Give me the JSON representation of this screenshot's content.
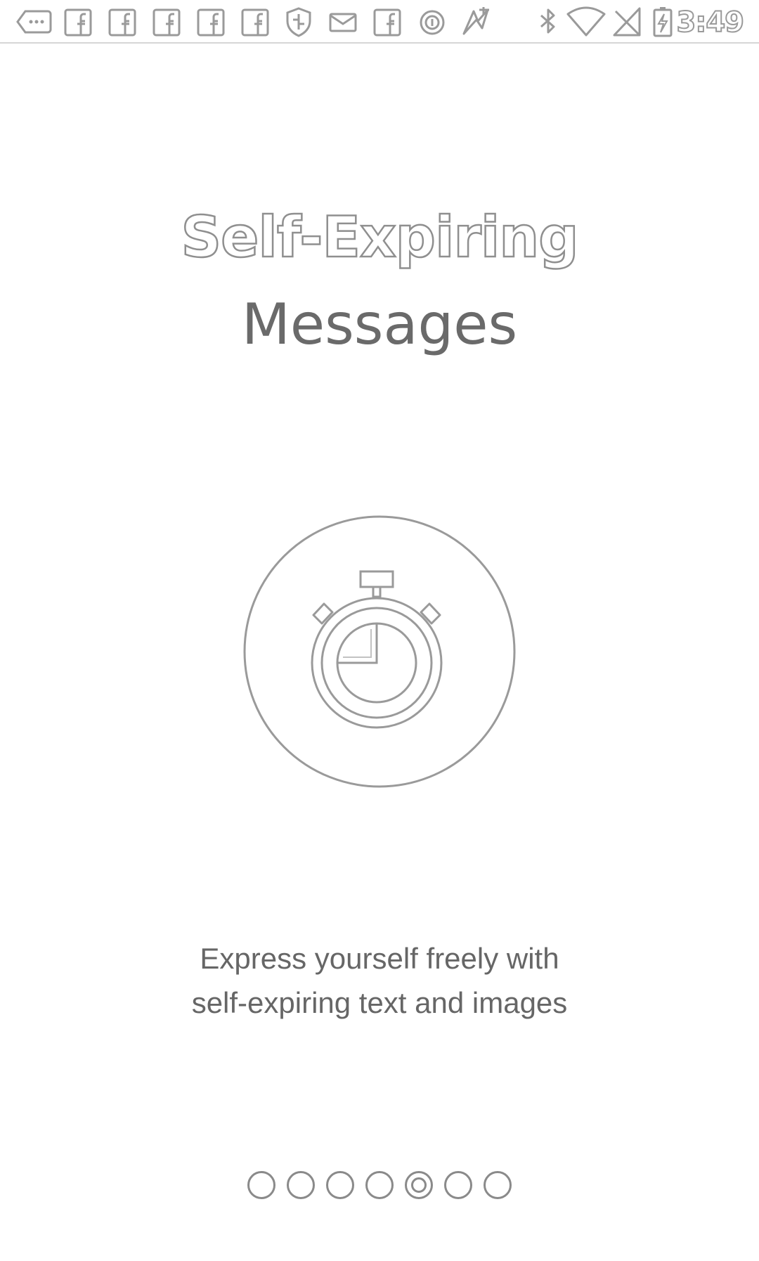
{
  "status_bar": {
    "time": "3:49",
    "notification_icons": [
      "more-notifications-icon",
      "facebook-icon",
      "facebook-icon",
      "facebook-icon",
      "facebook-icon",
      "facebook-icon",
      "shield-icon",
      "mail-icon",
      "facebook-icon",
      "circle-info-icon",
      "app-logo-icon"
    ],
    "system_icons": [
      "bluetooth-icon",
      "wifi-icon",
      "no-signal-icon",
      "battery-charging-icon"
    ]
  },
  "onboarding": {
    "title_line1": "Self-Expiring",
    "title_line2": "Messages",
    "illustration_icon": "stopwatch-icon",
    "description_line1": "Express yourself freely with",
    "description_line2": "self-expiring text and images",
    "page_count": 7,
    "active_page": 5
  },
  "colors": {
    "background": "#ffffff",
    "icon_stroke": "#8a8a8a",
    "text": "#666666"
  }
}
